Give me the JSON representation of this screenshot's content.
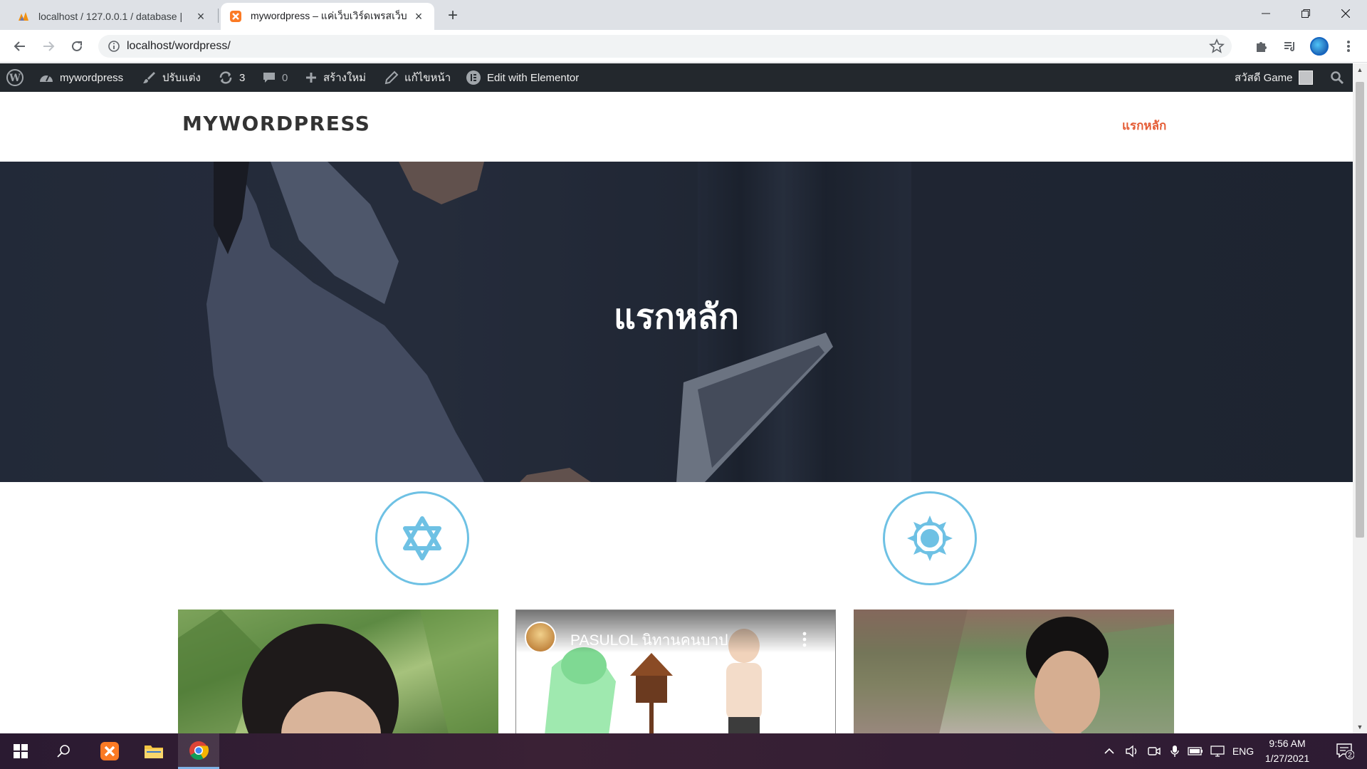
{
  "browser": {
    "tabs": [
      {
        "title": "localhost / 127.0.0.1 / database |",
        "active": false,
        "icon": "phpmyadmin-icon"
      },
      {
        "title": "mywordpress – แค่เว็บเวิร์ดเพรสเว็บ",
        "active": true,
        "icon": "xampp-icon"
      }
    ],
    "url": "localhost/wordpress/"
  },
  "admin_bar": {
    "site_name": "mywordpress",
    "customize": "ปรับแต่ง",
    "updates_count": "3",
    "comments_count": "0",
    "new_label": "สร้างใหม่",
    "edit_page": "แก้ไขหน้า",
    "elementor": "Edit with Elementor",
    "greeting": "สวัสดี Game"
  },
  "site": {
    "title": "MYWORDPRESS",
    "nav_home": "แรกหลัก"
  },
  "hero": {
    "title": "แรกหลัก"
  },
  "features": [
    {
      "icon": "star-of-david-icon"
    },
    {
      "icon": "sun-icon"
    }
  ],
  "video": {
    "title": "PASULOL นิทานคนบาป"
  },
  "taskbar": {
    "language": "ENG",
    "time": "9:56 AM",
    "date": "1/27/2021",
    "notifications": "2"
  },
  "colors": {
    "admin_bar": "#23282d",
    "accent_orange": "#e45c35",
    "icon_blue": "#6ec1e4"
  }
}
